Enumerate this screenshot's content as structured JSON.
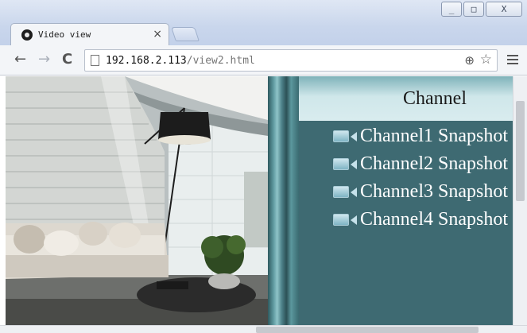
{
  "window": {
    "controls": {
      "minimize": "_",
      "maximize": "□",
      "close": "X"
    }
  },
  "tab": {
    "title": "Video view",
    "close_label": "×",
    "favicon": "camera-favicon-icon"
  },
  "toolbar": {
    "back_icon": "←",
    "forward_icon": "→",
    "reload_icon": "C",
    "url_host": "192.168.2.113",
    "url_path": "/view2.html",
    "zoom_icon": "⊕",
    "bookmark_icon": "☆"
  },
  "video": {
    "description_icon": "live-video-feed"
  },
  "channel_panel": {
    "header": "Channel",
    "items": [
      {
        "label": "Channel1 Snapshot",
        "icon": "camera-icon"
      },
      {
        "label": "Channel2 Snapshot",
        "icon": "camera-icon"
      },
      {
        "label": "Channel3 Snapshot",
        "icon": "camera-icon"
      },
      {
        "label": "Channel4 Snapshot",
        "icon": "camera-icon"
      }
    ]
  },
  "colors": {
    "panel_bg": "#3e6a72",
    "header_bg": "#d9ecef",
    "titlebar": "#c9d6ec"
  }
}
